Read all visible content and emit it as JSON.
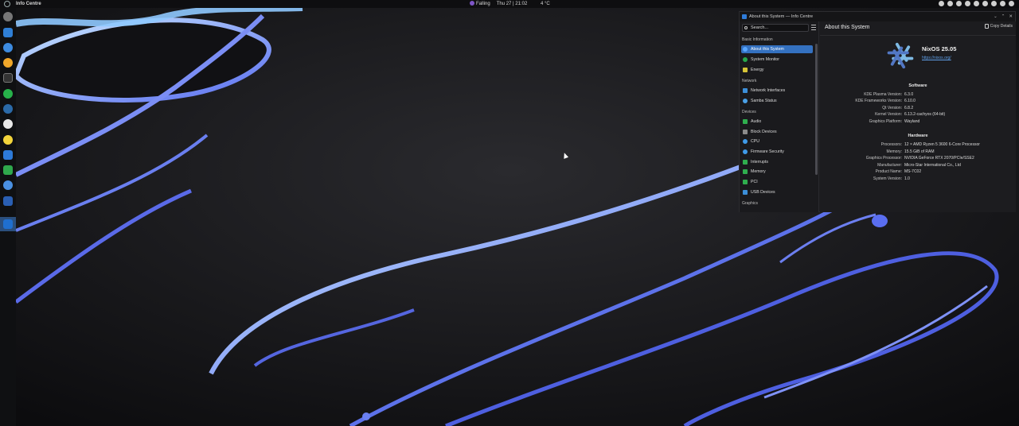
{
  "top_panel": {
    "app_name": "Info Centre",
    "media_tag": "Falling",
    "datetime": "Thu 27 | 21:02",
    "temperature": "4 °C"
  },
  "window": {
    "title": "About this System — Info Centre",
    "controls": [
      "chevron-down-icon",
      "chevron-up-icon",
      "close-icon"
    ]
  },
  "sidebar": {
    "search_placeholder": "Search...",
    "sections": [
      {
        "label": "Basic Information"
      },
      {
        "label": "Network"
      },
      {
        "label": "Devices"
      },
      {
        "label": "Graphics"
      }
    ],
    "items": [
      {
        "label": "About this System",
        "selected": true
      },
      {
        "label": "System Monitor"
      },
      {
        "label": "Energy"
      },
      {
        "label": "Network Interfaces"
      },
      {
        "label": "Samba Status"
      },
      {
        "label": "Audio"
      },
      {
        "label": "Block Devices"
      },
      {
        "label": "CPU"
      },
      {
        "label": "Firmware Security"
      },
      {
        "label": "Interrupts"
      },
      {
        "label": "Memory"
      },
      {
        "label": "PCI"
      },
      {
        "label": "USB Devices"
      }
    ]
  },
  "content": {
    "page_title": "About this System",
    "copy_label": "Copy Details",
    "os_name": "NixOS 25.05",
    "os_url": "https://nixos.org/",
    "software": {
      "title": "Software",
      "rows": [
        {
          "key": "KDE Plasma Version:",
          "value": "6.3.0"
        },
        {
          "key": "KDE Frameworks Version:",
          "value": "6.10.0"
        },
        {
          "key": "Qt Version:",
          "value": "6.8.2"
        },
        {
          "key": "Kernel Version:",
          "value": "6.13.2-cachyos (64-bit)"
        },
        {
          "key": "Graphics Platform:",
          "value": "Wayland"
        }
      ]
    },
    "hardware": {
      "title": "Hardware",
      "rows": [
        {
          "key": "Processors:",
          "value": "12 × AMD Ryzen 5 3600 6-Core Processor"
        },
        {
          "key": "Memory:",
          "value": "15.5 GiB of RAM"
        },
        {
          "key": "Graphics Processor:",
          "value": "NVIDIA GeForce RTX 2070/PCIe/SSE2"
        },
        {
          "key": "Manufacturer:",
          "value": "Micro-Star International Co., Ltd"
        },
        {
          "key": "Product Name:",
          "value": "MS-7C02"
        },
        {
          "key": "System Version:",
          "value": "1.0"
        }
      ]
    }
  },
  "colors": {
    "accent": "#3471c0",
    "link": "#5e9ee6",
    "nix_logo": "#7ebae4"
  }
}
